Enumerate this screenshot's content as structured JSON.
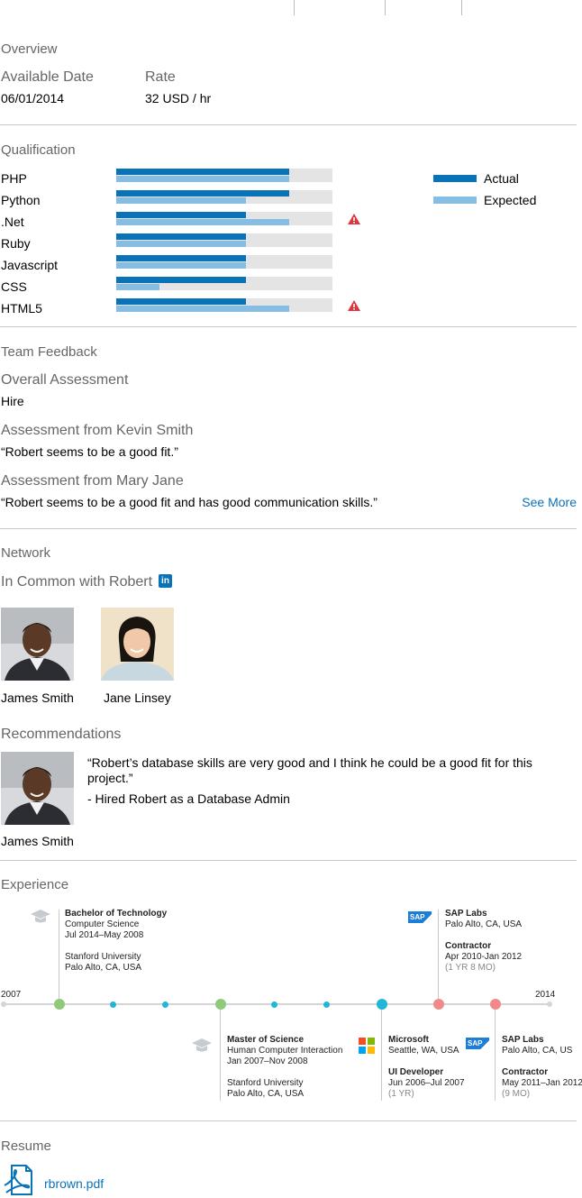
{
  "overview": {
    "title": "Overview",
    "available_label": "Available Date",
    "available_value": "06/01/2014",
    "rate_label": "Rate",
    "rate_value": "32 USD / hr"
  },
  "qualification": {
    "title": "Qualification",
    "legend_actual": "Actual",
    "legend_expected": "Expected",
    "colors": {
      "actual": "#0a72b7",
      "expected": "#86bde2",
      "warning": "#d9363e"
    },
    "skills": [
      {
        "name": "PHP",
        "actual": 0.8,
        "expected": 0.8,
        "warning": false
      },
      {
        "name": "Python",
        "actual": 0.8,
        "expected": 0.6,
        "warning": false
      },
      {
        "name": ".Net",
        "actual": 0.6,
        "expected": 0.8,
        "warning": true
      },
      {
        "name": "Ruby",
        "actual": 0.6,
        "expected": 0.6,
        "warning": false
      },
      {
        "name": "Javascript",
        "actual": 0.6,
        "expected": 0.6,
        "warning": false
      },
      {
        "name": "CSS",
        "actual": 0.6,
        "expected": 0.2,
        "warning": false
      },
      {
        "name": "HTML5",
        "actual": 0.6,
        "expected": 0.8,
        "warning": true
      }
    ]
  },
  "feedback": {
    "title": "Team Feedback",
    "overall_label": "Overall Assessment",
    "overall_value": "Hire",
    "kevin_label": "Assessment from Kevin Smith",
    "kevin_value": "“Robert seems to be a good fit.”",
    "mary_label": "Assessment from Mary Jane",
    "mary_value": "“Robert seems to be a good fit and has good communication skills.”",
    "see_more": "See More"
  },
  "network": {
    "title": "Network",
    "in_common": "In Common with Robert",
    "people": [
      "James Smith",
      "Jane Linsey"
    ],
    "recommendations_label": "Recommendations",
    "rec_quote": "“Robert’s database skills are very good and I think he could be a good fit for this project.”",
    "rec_role": "- Hired Robert as a Database Admin",
    "rec_name": "James Smith"
  },
  "experience": {
    "title": "Experience",
    "start_year": "2007",
    "end_year": "2014",
    "above": [
      {
        "title": "Bachelor of Technology",
        "line1": "Computer Science",
        "line2": "Jul 2014–May 2008",
        "line3": "Stanford University",
        "line4": "Palo Alto, CA, USA"
      },
      {
        "title": "SAP Labs",
        "line1": "Palo Alto, CA, USA",
        "line2": "Contractor",
        "line3": "Apr 2010-Jan 2012",
        "line4": "(1 YR 8 MO)"
      }
    ],
    "below": [
      {
        "title": "Master of Science",
        "line1": "Human Computer Interaction",
        "line2": "Jan 2007–Nov 2008",
        "line3": "Stanford University",
        "line4": "Palo Alto, CA, USA"
      },
      {
        "title": "Microsoft",
        "line1": "Seattle, WA, USA",
        "line2": "UI Developer",
        "line3": "Jun 2006–Jul 2007",
        "line4": "(1 YR)"
      },
      {
        "title": "SAP Labs",
        "line1": "Palo Alto, CA, US",
        "line2": "Contractor",
        "line3": "May 2011–Jan 2012",
        "line4": "(9 MO)"
      }
    ],
    "sap_logo": "SAP",
    "colors": {
      "education": "#8fc97a",
      "job": "#f08a8a",
      "current": "#21b6d7",
      "axis": "#d5d5d5"
    }
  },
  "resume": {
    "title": "Resume",
    "file": "rbrown.pdf",
    "link_color": "#0a72b7"
  }
}
